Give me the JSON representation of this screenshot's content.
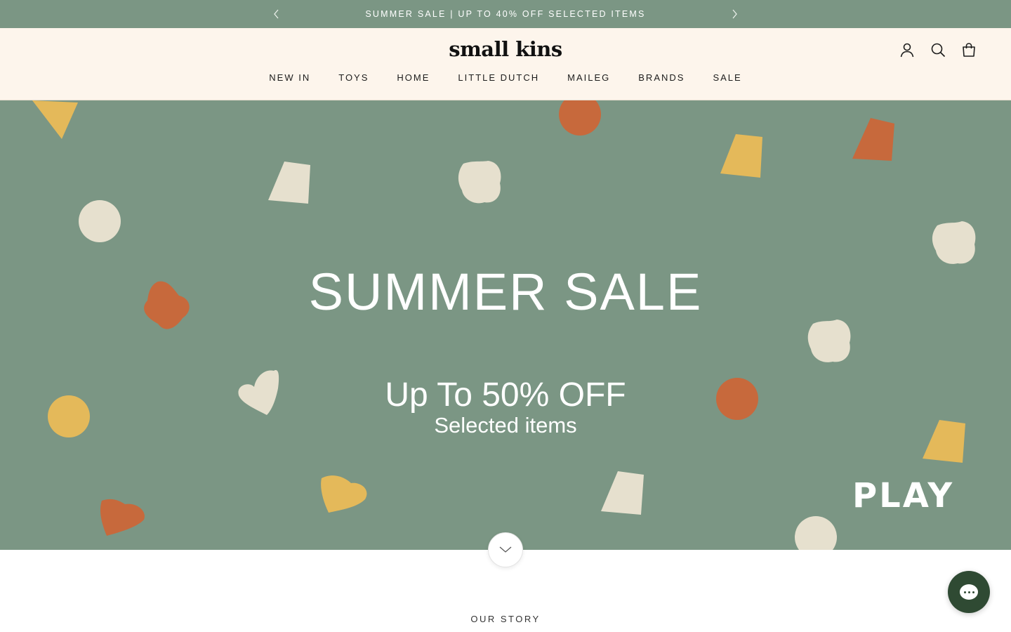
{
  "announcement": {
    "text": "SUMMER SALE | UP TO 40% OFF SELECTED ITEMS",
    "prev_icon": "chevron-left-icon",
    "next_icon": "chevron-right-icon"
  },
  "header": {
    "logo": "small kins",
    "icons": [
      "account-icon",
      "search-icon",
      "bag-icon"
    ],
    "nav": [
      "NEW IN",
      "TOYS",
      "HOME",
      "LITTLE DUTCH",
      "MAILEG",
      "BRANDS",
      "SALE"
    ]
  },
  "hero": {
    "title": "SUMMER SALE",
    "subtitle": "Up To 50% OFF",
    "subtitle2": "Selected items",
    "play_text": "PLAY",
    "background": "#7b9684",
    "shape_colors": {
      "yellow": "#e4b95a",
      "orange": "#c7693c",
      "cream": "#e6e0ce"
    }
  },
  "scroll_button": {
    "icon": "chevron-down-icon"
  },
  "story": {
    "label": "OUR STORY"
  },
  "chat": {
    "icon": "chat-icon",
    "color": "#2f4a33"
  }
}
